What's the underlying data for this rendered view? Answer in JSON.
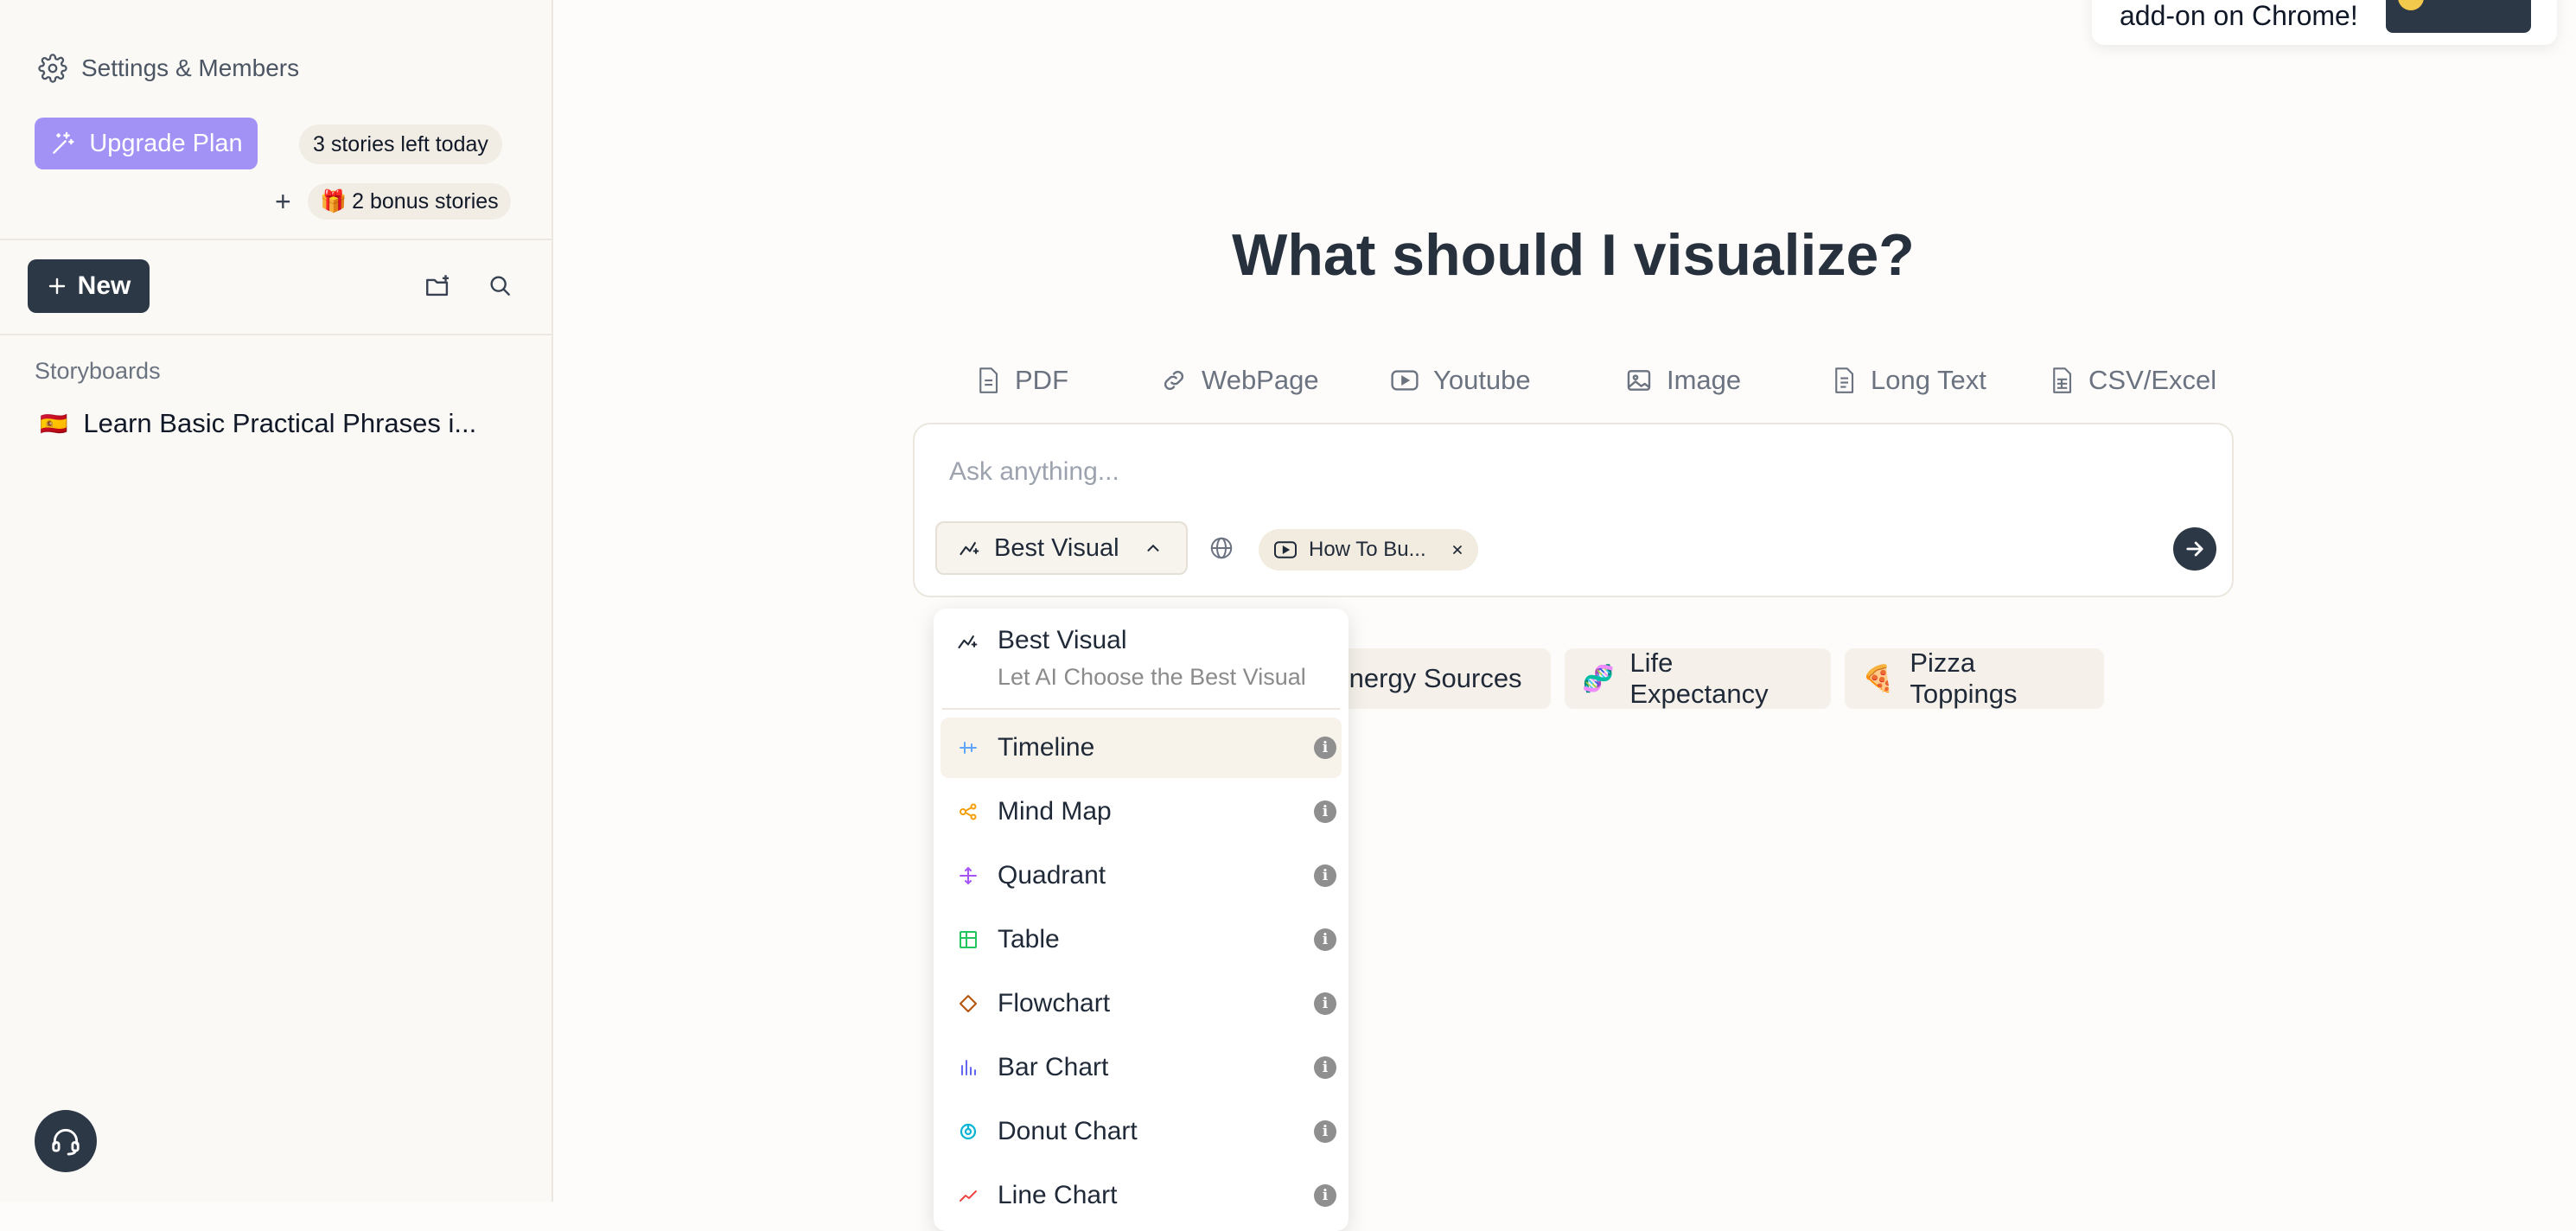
{
  "sidebar": {
    "settings_label": "Settings & Members",
    "upgrade_label": "Upgrade Plan",
    "stories_left": "3 stories left today",
    "plus": "+",
    "bonus_emoji": "🎁",
    "bonus_label": "2 bonus stories",
    "new_label": "New",
    "storyboards_heading": "Storyboards",
    "story_flag": "🇪🇸",
    "story_title": "Learn Basic Practical Phrases i..."
  },
  "toast": {
    "text": "add-on on Chrome!"
  },
  "main": {
    "title": "What should I visualize?",
    "tabs": [
      {
        "label": "PDF",
        "icon": "pdf-icon"
      },
      {
        "label": "WebPage",
        "icon": "link-icon"
      },
      {
        "label": "Youtube",
        "icon": "youtube-icon"
      },
      {
        "label": "Image",
        "icon": "image-icon"
      },
      {
        "label": "Long Text",
        "icon": "document-icon"
      },
      {
        "label": "CSV/Excel",
        "icon": "spreadsheet-icon"
      }
    ],
    "input_placeholder": "Ask anything...",
    "visual_select_label": "Best Visual",
    "source_chip_label": "How To Bu...",
    "suggestions": [
      {
        "emoji": "",
        "label": "Energy Sources"
      },
      {
        "emoji": "🧬",
        "label": "Life Expectancy"
      },
      {
        "emoji": "🍕",
        "label": "Pizza Toppings"
      }
    ]
  },
  "dropdown": {
    "best_title": "Best Visual",
    "best_subtitle": "Let AI Choose the Best Visual",
    "info_glyph": "i",
    "items": [
      {
        "label": "Timeline",
        "icon": "timeline-icon",
        "color": "#60a5fa",
        "active": true
      },
      {
        "label": "Mind Map",
        "icon": "mind-map-icon",
        "color": "#f59e0b"
      },
      {
        "label": "Quadrant",
        "icon": "quadrant-icon",
        "color": "#a855f7"
      },
      {
        "label": "Table",
        "icon": "table-icon",
        "color": "#22c55e"
      },
      {
        "label": "Flowchart",
        "icon": "flowchart-icon",
        "color": "#b45309"
      },
      {
        "label": "Bar Chart",
        "icon": "bar-chart-icon",
        "color": "#6366f1"
      },
      {
        "label": "Donut Chart",
        "icon": "donut-chart-icon",
        "color": "#06b6d4"
      },
      {
        "label": "Line Chart",
        "icon": "line-chart-icon",
        "color": "#ef4444"
      }
    ]
  },
  "colors": {
    "accent": "#a292f5",
    "dark_button": "#2d3846",
    "background": "#fdfcfa"
  }
}
